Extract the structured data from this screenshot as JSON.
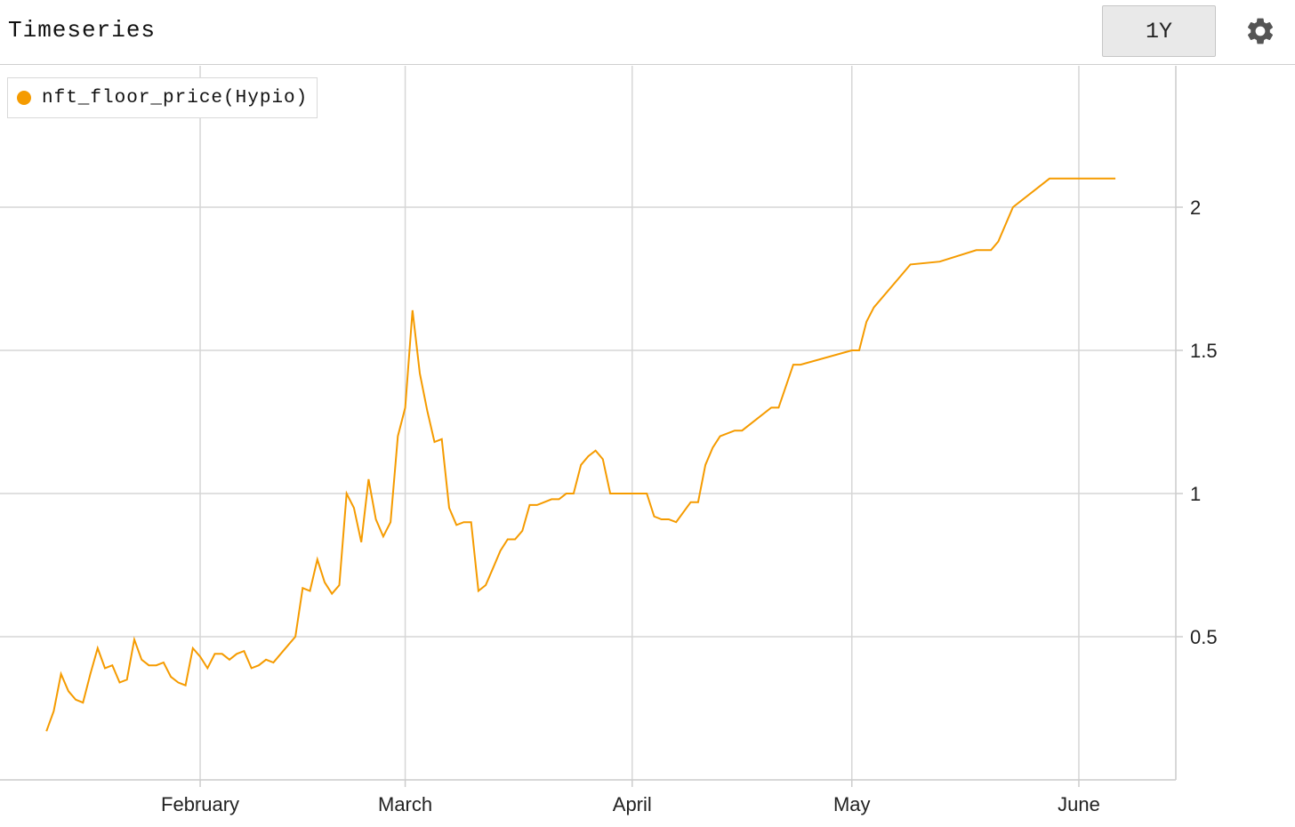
{
  "header": {
    "title": "Timeseries",
    "range_button_label": "1Y",
    "settings_icon": "gear-icon"
  },
  "legend": {
    "label": "nft_floor_price(Hypio)",
    "color": "#f59b00"
  },
  "chart_data": {
    "type": "line",
    "title": "",
    "xlabel": "",
    "ylabel": "",
    "xlim": [
      "2022-01-06",
      "2022-06-14"
    ],
    "ylim": [
      0,
      2.4
    ],
    "y_ticks": [
      0.5,
      1,
      1.5,
      2
    ],
    "y_tick_labels": [
      "0.5",
      "1",
      "1.5",
      "2"
    ],
    "x_ticks": [
      "2022-02-01",
      "2022-03-01",
      "2022-04-01",
      "2022-05-01",
      "2022-06-01"
    ],
    "x_tick_labels": [
      "February",
      "March",
      "April",
      "May",
      "June"
    ],
    "grid": true,
    "legend_position": "top-left",
    "series": [
      {
        "name": "nft_floor_price(Hypio)",
        "color": "#f59b00",
        "points": [
          [
            "2022-01-11",
            0.17
          ],
          [
            "2022-01-12",
            0.24
          ],
          [
            "2022-01-13",
            0.37
          ],
          [
            "2022-01-14",
            0.31
          ],
          [
            "2022-01-15",
            0.28
          ],
          [
            "2022-01-16",
            0.27
          ],
          [
            "2022-01-17",
            0.37
          ],
          [
            "2022-01-18",
            0.46
          ],
          [
            "2022-01-19",
            0.39
          ],
          [
            "2022-01-20",
            0.4
          ],
          [
            "2022-01-21",
            0.34
          ],
          [
            "2022-01-22",
            0.35
          ],
          [
            "2022-01-23",
            0.49
          ],
          [
            "2022-01-24",
            0.42
          ],
          [
            "2022-01-25",
            0.4
          ],
          [
            "2022-01-26",
            0.4
          ],
          [
            "2022-01-27",
            0.41
          ],
          [
            "2022-01-28",
            0.36
          ],
          [
            "2022-01-29",
            0.34
          ],
          [
            "2022-01-30",
            0.33
          ],
          [
            "2022-01-31",
            0.46
          ],
          [
            "2022-02-01",
            0.43
          ],
          [
            "2022-02-02",
            0.39
          ],
          [
            "2022-02-03",
            0.44
          ],
          [
            "2022-02-04",
            0.44
          ],
          [
            "2022-02-05",
            0.42
          ],
          [
            "2022-02-06",
            0.44
          ],
          [
            "2022-02-07",
            0.45
          ],
          [
            "2022-02-08",
            0.39
          ],
          [
            "2022-02-09",
            0.4
          ],
          [
            "2022-02-10",
            0.42
          ],
          [
            "2022-02-11",
            0.41
          ],
          [
            "2022-02-12",
            0.44
          ],
          [
            "2022-02-13",
            0.47
          ],
          [
            "2022-02-14",
            0.5
          ],
          [
            "2022-02-15",
            0.67
          ],
          [
            "2022-02-16",
            0.66
          ],
          [
            "2022-02-17",
            0.77
          ],
          [
            "2022-02-18",
            0.69
          ],
          [
            "2022-02-19",
            0.65
          ],
          [
            "2022-02-20",
            0.68
          ],
          [
            "2022-02-21",
            1.0
          ],
          [
            "2022-02-22",
            0.95
          ],
          [
            "2022-02-23",
            0.83
          ],
          [
            "2022-02-24",
            1.05
          ],
          [
            "2022-02-25",
            0.91
          ],
          [
            "2022-02-26",
            0.85
          ],
          [
            "2022-02-27",
            0.9
          ],
          [
            "2022-02-28",
            1.2
          ],
          [
            "2022-03-01",
            1.3
          ],
          [
            "2022-03-02",
            1.64
          ],
          [
            "2022-03-03",
            1.42
          ],
          [
            "2022-03-04",
            1.29
          ],
          [
            "2022-03-05",
            1.18
          ],
          [
            "2022-03-06",
            1.19
          ],
          [
            "2022-03-07",
            0.95
          ],
          [
            "2022-03-08",
            0.89
          ],
          [
            "2022-03-09",
            0.9
          ],
          [
            "2022-03-10",
            0.9
          ],
          [
            "2022-03-11",
            0.66
          ],
          [
            "2022-03-12",
            0.68
          ],
          [
            "2022-03-13",
            0.74
          ],
          [
            "2022-03-14",
            0.8
          ],
          [
            "2022-03-15",
            0.84
          ],
          [
            "2022-03-16",
            0.84
          ],
          [
            "2022-03-17",
            0.87
          ],
          [
            "2022-03-18",
            0.96
          ],
          [
            "2022-03-19",
            0.96
          ],
          [
            "2022-03-20",
            0.97
          ],
          [
            "2022-03-21",
            0.98
          ],
          [
            "2022-03-22",
            0.98
          ],
          [
            "2022-03-23",
            1.0
          ],
          [
            "2022-03-24",
            1.0
          ],
          [
            "2022-03-25",
            1.1
          ],
          [
            "2022-03-26",
            1.13
          ],
          [
            "2022-03-27",
            1.15
          ],
          [
            "2022-03-28",
            1.12
          ],
          [
            "2022-03-29",
            1.0
          ],
          [
            "2022-04-03",
            1.0
          ],
          [
            "2022-04-04",
            0.92
          ],
          [
            "2022-04-05",
            0.91
          ],
          [
            "2022-04-06",
            0.91
          ],
          [
            "2022-04-07",
            0.9
          ],
          [
            "2022-04-09",
            0.97
          ],
          [
            "2022-04-10",
            0.97
          ],
          [
            "2022-04-11",
            1.1
          ],
          [
            "2022-04-12",
            1.16
          ],
          [
            "2022-04-13",
            1.2
          ],
          [
            "2022-04-15",
            1.22
          ],
          [
            "2022-04-16",
            1.22
          ],
          [
            "2022-04-20",
            1.3
          ],
          [
            "2022-04-21",
            1.3
          ],
          [
            "2022-04-23",
            1.45
          ],
          [
            "2022-04-24",
            1.45
          ],
          [
            "2022-05-01",
            1.5
          ],
          [
            "2022-05-02",
            1.5
          ],
          [
            "2022-05-03",
            1.6
          ],
          [
            "2022-05-04",
            1.65
          ],
          [
            "2022-05-08",
            1.77
          ],
          [
            "2022-05-09",
            1.8
          ],
          [
            "2022-05-13",
            1.81
          ],
          [
            "2022-05-18",
            1.85
          ],
          [
            "2022-05-20",
            1.85
          ],
          [
            "2022-05-21",
            1.88
          ],
          [
            "2022-05-23",
            2.0
          ],
          [
            "2022-05-28",
            2.1
          ],
          [
            "2022-06-06",
            2.1
          ]
        ]
      }
    ]
  }
}
